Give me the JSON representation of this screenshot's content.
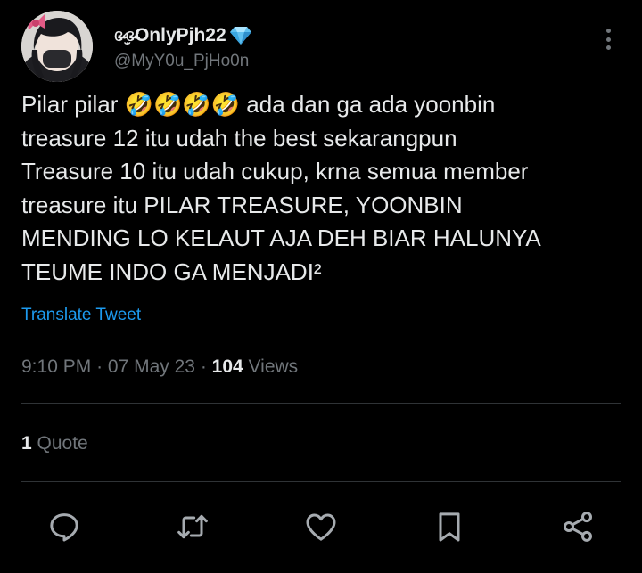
{
  "author": {
    "display_name": "OnlyPjh22",
    "name_decoration": "ɞ̴̶̷·̫̮ɞ̴̶̷",
    "handle": "@MyY0u_PjHo0n"
  },
  "tweet": {
    "text": "Pilar pilar 🤣🤣🤣🤣 ada dan ga ada yoonbin\ntreasure 12 itu udah the best sekarangpun\nTreasure 10 itu udah cukup, krna semua member\ntreasure itu PILAR TREASURE, YOONBIN\nMENDING LO KELAUT AJA DEH BIAR HALUNYA\nTEUME INDO GA MENJADI²",
    "translate_label": "Translate Tweet",
    "time": "9:10 PM",
    "date": "07 May 23",
    "views_count": "104",
    "views_label": "Views",
    "separator": "·"
  },
  "engagement": {
    "quote_count": "1",
    "quote_label": "Quote"
  },
  "icons": {
    "verified": "diamond-icon",
    "more": "more-icon",
    "reply": "reply-icon",
    "retweet": "retweet-icon",
    "like": "heart-icon",
    "bookmark": "bookmark-icon",
    "share": "share-icon"
  },
  "colors": {
    "background": "#000000",
    "text": "#e7e9ea",
    "muted": "#71767b",
    "link": "#1d9bf0",
    "divider": "#2f3336"
  }
}
